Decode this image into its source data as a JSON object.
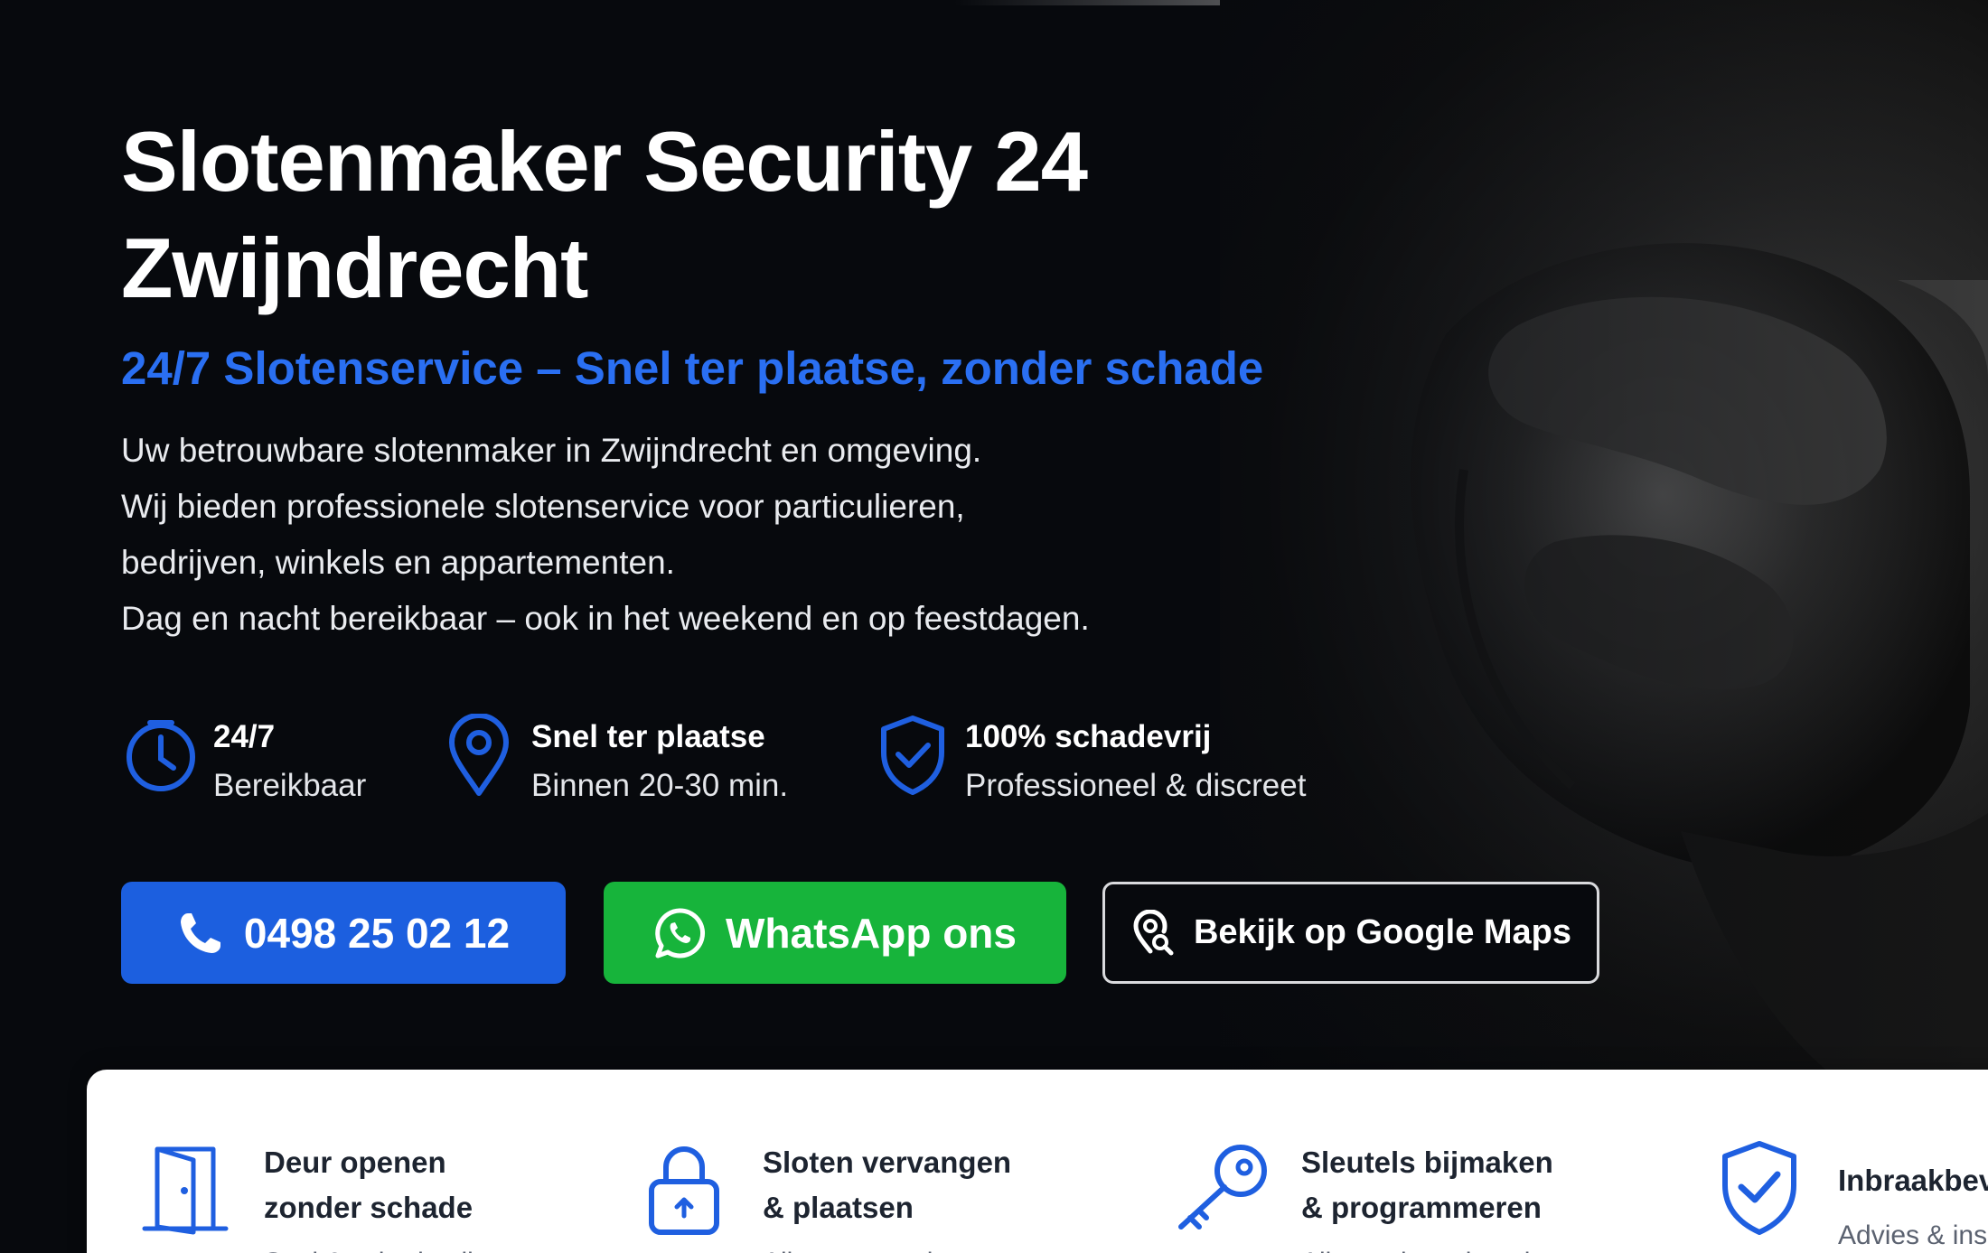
{
  "hero": {
    "title_line1": "Slotenmaker Security 24",
    "title_line2": "Zwijndrecht",
    "subtitle": "24/7 Slotenservice – Snel ter plaatse, zonder schade",
    "intro": [
      "Uw betrouwbare slotenmaker in Zwijndrecht en omgeving.",
      "Wij bieden professionele slotenservice voor particulieren,",
      "bedrijven, winkels en appartementen.",
      "Dag en nacht bereikbaar – ook in het weekend en op feestdagen."
    ]
  },
  "features": [
    {
      "icon": "clock-icon",
      "title": "24/7",
      "subtitle": "Bereikbaar"
    },
    {
      "icon": "location-pin-icon",
      "title": "Snel ter plaatse",
      "subtitle": "Binnen 20-30 min."
    },
    {
      "icon": "shield-check-icon",
      "title": "100% schadevrij",
      "subtitle": "Professioneel & discreet"
    }
  ],
  "buttons": {
    "call": {
      "icon": "phone-icon",
      "label": "0498 25 02 12"
    },
    "whatsapp": {
      "icon": "whatsapp-icon",
      "label": "WhatsApp ons"
    },
    "maps": {
      "icon": "map-search-icon",
      "label": "Bekijk op Google Maps"
    }
  },
  "services": [
    {
      "icon": "door-icon",
      "title_line1": "Deur openen",
      "title_line2": "zonder schade",
      "desc": "Snel & schadevrij"
    },
    {
      "icon": "padlock-icon",
      "title_line1": "Sloten vervangen",
      "title_line2": "& plaatsen",
      "desc": "Alle soorten sloten"
    },
    {
      "icon": "key-icon",
      "title_line1": "Sleutels bijmaken",
      "title_line2": "& programmeren",
      "desc": "Alle merken sleutels"
    },
    {
      "icon": "shield-check-icon",
      "title_line1": "Inbraakbev",
      "desc": "Advies & ins"
    }
  ],
  "colors": {
    "accent_blue": "#1c5fdf",
    "subtitle_blue": "#2a6ff2",
    "whatsapp_green": "#17b43b",
    "hero_background": "#07090d",
    "icon_blue": "#1f5fe0"
  }
}
